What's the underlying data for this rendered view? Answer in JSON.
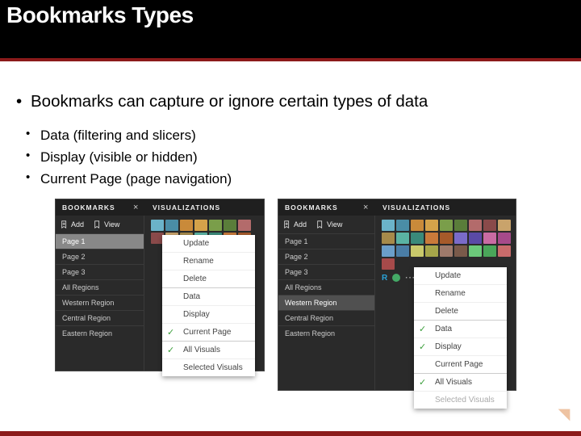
{
  "title": "Bookmarks Types",
  "main_bullet": "Bookmarks can capture or ignore certain types of data",
  "sub_bullets": [
    "Data (filtering and slicers)",
    "Display (visible or hidden)",
    "Current Page (page navigation)"
  ],
  "pane": {
    "bookmarks_header": "BOOKMARKS",
    "visualizations_header": "VISUALIZATIONS",
    "close": "×",
    "add": "Add",
    "view": "View"
  },
  "shotA": {
    "items": [
      "Page 1",
      "Page 2",
      "Page 3",
      "All Regions",
      "Western Region",
      "Central Region",
      "Eastern Region"
    ],
    "selected_index": 0,
    "menu": [
      {
        "label": "Update"
      },
      {
        "label": "Rename"
      },
      {
        "label": "Delete"
      },
      {
        "label": "Data",
        "sep": true
      },
      {
        "label": "Display"
      },
      {
        "label": "Current Page",
        "checked": true
      },
      {
        "label": "All Visuals",
        "checked": true,
        "sep": true
      },
      {
        "label": "Selected Visuals"
      }
    ]
  },
  "shotB": {
    "items": [
      "Page 1",
      "Page 2",
      "Page 3",
      "All Regions",
      "Western Region",
      "Central Region",
      "Eastern Region"
    ],
    "selected_index": 4,
    "menu": [
      {
        "label": "Update"
      },
      {
        "label": "Rename"
      },
      {
        "label": "Delete"
      },
      {
        "label": "Data",
        "checked": true,
        "sep": true
      },
      {
        "label": "Display",
        "checked": true
      },
      {
        "label": "Current Page"
      },
      {
        "label": "All Visuals",
        "checked": true,
        "sep": true
      },
      {
        "label": "Selected Visuals",
        "disabled": true
      }
    ],
    "letters": [
      "R"
    ]
  },
  "vis_palette": [
    "#6bb3c9",
    "#4a8da6",
    "#c98a3a",
    "#d4a24a",
    "#7a9e4a",
    "#5a7d3a",
    "#b36b6b",
    "#8a4a4a",
    "#c9a36b",
    "#a68a4a",
    "#5ab3a3",
    "#3a8a7a",
    "#c97a3a",
    "#a65a2a",
    "#7a6bc9",
    "#5a4aa6",
    "#c96ba3",
    "#a64a8a",
    "#6b9ec9",
    "#4a7da6",
    "#c9c96b",
    "#a6a64a",
    "#9e7a6b",
    "#7a5a4a",
    "#6bc97a",
    "#4aa65a",
    "#c96b6b",
    "#a64a4a"
  ]
}
